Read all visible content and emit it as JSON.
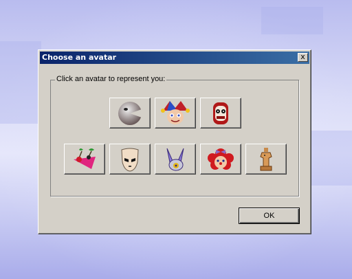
{
  "dialog": {
    "title": "Choose an avatar",
    "close_label": "x",
    "group_label": "Click an avatar to represent you:",
    "ok_label": "OK"
  },
  "avatars": [
    {
      "icon": "gloink-icon"
    },
    {
      "icon": "jester-icon"
    },
    {
      "icon": "ringmaster-icon"
    },
    {
      "icon": "cherries-icon"
    },
    {
      "icon": "mask-icon"
    },
    {
      "icon": "bunny-icon"
    },
    {
      "icon": "clown-doll-icon"
    },
    {
      "icon": "chess-piece-icon"
    }
  ],
  "colors": {
    "titlebar_start": "#0a246a",
    "titlebar_end": "#3a6ea5",
    "dialog_face": "#d4d0c8"
  }
}
